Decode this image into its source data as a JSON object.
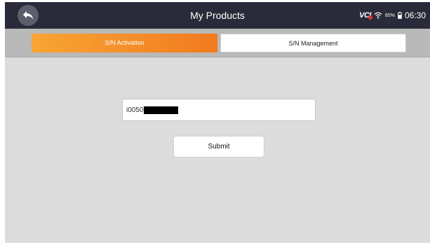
{
  "header": {
    "title": "My Products",
    "back_icon": "back-arrow-icon"
  },
  "status_bar": {
    "vci_label": "VCI",
    "battery_percent": "65%",
    "time": "06:30",
    "wifi_icon": "wifi-icon",
    "battery_icon": "battery-icon"
  },
  "tabs": [
    {
      "label": "S/N Activation",
      "active": true
    },
    {
      "label": "S/N Management",
      "active": false
    }
  ],
  "form": {
    "serial_prefix": "i0050",
    "serial_redacted": true,
    "submit_label": "Submit"
  },
  "colors": {
    "topbar": "#2a2b3a",
    "active_tab_start": "#f7a534",
    "active_tab_end": "#f27a1f",
    "background": "#dcdcdc"
  }
}
